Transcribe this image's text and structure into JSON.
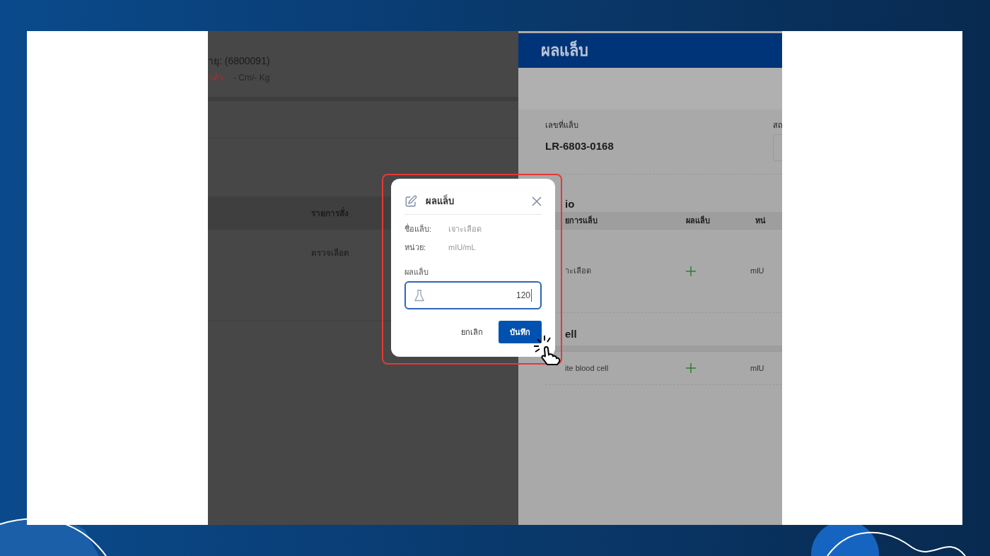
{
  "left_page": {
    "patient_code": "ายุ: (6800091)",
    "body_label": "าตัว",
    "body_value": "- Cm/- Kg",
    "order_column": "รายการสั่ง",
    "order_cell": "ตรวจเลือด"
  },
  "lab_panel": {
    "title": "ผลแล็บ",
    "lab_number_label": "เลขที่แล็บ",
    "lab_number": "LR-6803-0168",
    "status_label": "สถ",
    "sections": [
      {
        "title": "io",
        "columns": [
          "ยการแล็บ",
          "ผลแล็บ",
          "หน่"
        ],
        "rows": [
          {
            "name": "าะเลือด",
            "unit": "mlU"
          }
        ]
      },
      {
        "title": "ell",
        "rows": [
          {
            "name": "ite blood cell",
            "unit": "mlU"
          }
        ]
      }
    ]
  },
  "dialog": {
    "title": "ผลแล็บ",
    "fields": [
      {
        "label": "ชื่อแล็บ:",
        "value": "เจาะเลือด"
      },
      {
        "label": "หน่วย:",
        "value": "mIU/mL"
      }
    ],
    "input_label": "ผลแล็บ",
    "input_value": "120",
    "cancel": "ยกเลิก",
    "save": "บันทึก"
  }
}
